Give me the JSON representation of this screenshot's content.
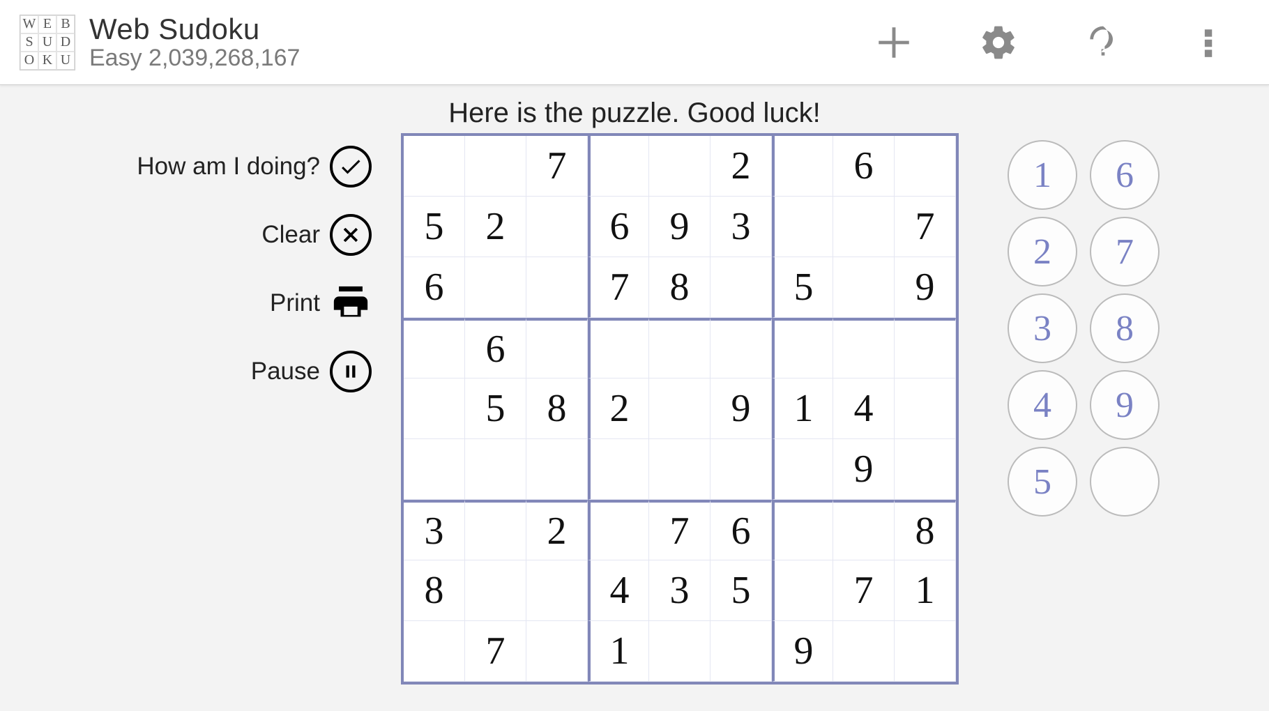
{
  "header": {
    "logo_letters": [
      "W",
      "E",
      "B",
      "S",
      "U",
      "D",
      "O",
      "K",
      "U"
    ],
    "title": "Web Sudoku",
    "subtitle": "Easy 2,039,268,167"
  },
  "status_text": "Here is the puzzle. Good luck!",
  "actions": {
    "check": "How am I doing?",
    "clear": "Clear",
    "print": "Print",
    "pause": "Pause"
  },
  "board": [
    [
      "",
      "",
      "7",
      "",
      "",
      "2",
      "",
      "6",
      ""
    ],
    [
      "5",
      "2",
      "",
      "6",
      "9",
      "3",
      "",
      "",
      "7"
    ],
    [
      "6",
      "",
      "",
      "7",
      "8",
      "",
      "5",
      "",
      "9"
    ],
    [
      "",
      "6",
      "",
      "",
      "",
      "",
      "",
      "",
      ""
    ],
    [
      "",
      "5",
      "8",
      "2",
      "",
      "9",
      "1",
      "4",
      ""
    ],
    [
      "",
      "",
      "",
      "",
      "",
      "",
      "",
      "9",
      ""
    ],
    [
      "3",
      "",
      "2",
      "",
      "7",
      "6",
      "",
      "",
      "8"
    ],
    [
      "8",
      "",
      "",
      "4",
      "3",
      "5",
      "",
      "7",
      "1"
    ],
    [
      "",
      "7",
      "",
      "1",
      "",
      "",
      "9",
      "",
      ""
    ]
  ],
  "numpad": [
    "1",
    "6",
    "2",
    "7",
    "3",
    "8",
    "4",
    "9",
    "5",
    ""
  ]
}
